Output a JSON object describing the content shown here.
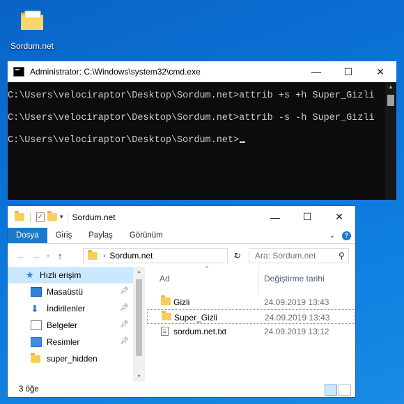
{
  "desktop": {
    "icon_label": "Sordum.net"
  },
  "cmd": {
    "title": "Administrator: C:\\Windows\\system32\\cmd.exe",
    "lines": [
      "C:\\Users\\velociraptor\\Desktop\\Sordum.net>attrib +s +h Super_Gizli",
      "C:\\Users\\velociraptor\\Desktop\\Sordum.net>attrib -s -h Super_Gizli",
      "C:\\Users\\velociraptor\\Desktop\\Sordum.net>"
    ],
    "buttons": {
      "min": "—",
      "max": "☐",
      "close": "✕"
    }
  },
  "explorer": {
    "title": "Sordum.net",
    "buttons": {
      "min": "—",
      "max": "☐",
      "close": "✕"
    },
    "ribbon_tabs": [
      "Dosya",
      "Giriş",
      "Paylaş",
      "Görünüm"
    ],
    "address": {
      "path": "Sordum.net"
    },
    "search": {
      "placeholder": "Ara: Sordum.net"
    },
    "columns": {
      "name": "Ad",
      "date": "Değiştirme tarihi"
    },
    "files": [
      {
        "name": "Gizli",
        "date": "24.09.2019 13:43",
        "type": "folder"
      },
      {
        "name": "Super_Gizli",
        "date": "24.09.2019 13:43",
        "type": "folder"
      },
      {
        "name": "sordum.net.txt",
        "date": "24.09.2019 13:12",
        "type": "txt"
      }
    ],
    "nav": {
      "quick_access": "Hızlı erişim",
      "items": [
        "Masaüstü",
        "İndirilenler",
        "Belgeler",
        "Resimler",
        "super_hidden"
      ]
    },
    "status": {
      "count": "3 öğe"
    }
  }
}
